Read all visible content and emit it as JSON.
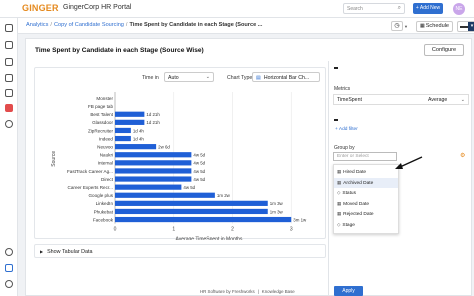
{
  "header": {
    "logo": "GINGER",
    "portal": "GingerCorp HR Portal",
    "search_placeholder": "Search",
    "add_new": "+ Add New",
    "avatar_initials": "NE"
  },
  "breadcrumb": {
    "items": [
      "Analytics",
      "Copy of Candidate Sourcing"
    ],
    "current": "Time Spent by Candidate in each Stage (Source ...",
    "schedule": "Schedule"
  },
  "page": {
    "title": "Time Spent by Candidate in each Stage (Source Wise)",
    "configure": "Configure",
    "time_in_label": "Time in",
    "time_in_value": "Auto",
    "chart_type_label": "Chart Type",
    "chart_type_value": "Horizontal Bar Ch...",
    "show_tabular": "Show Tabular Data"
  },
  "chart_data": {
    "type": "bar",
    "orientation": "horizontal",
    "categories": [
      "Monster",
      "FB page tab",
      "Best Talent",
      "Glassdoor",
      "ZipRecruiter",
      "Indeed",
      "Neuvoo",
      "Naukri",
      "Internal",
      "FastTrack Career Ag...",
      "Direct",
      "Career Experts Recr...",
      "Google plus",
      "LinkedIn",
      "Phukebat",
      "Facebook"
    ],
    "values": [
      0,
      0,
      0.5,
      0.5,
      0.27,
      0.27,
      0.7,
      1.3,
      1.3,
      1.3,
      1.3,
      1.13,
      1.7,
      2.6,
      2.6,
      3.0
    ],
    "data_labels": [
      "",
      "",
      "1d 21h",
      "1d 21h",
      "1d 4h",
      "1d 4h",
      "2w 6d",
      "4w 5d",
      "4w 5d",
      "4w 5d",
      "4w 5d",
      "4w 5d",
      "1m 2w",
      "1m 3w",
      "1m 3w",
      "3m 1w"
    ],
    "xlabel": "Average TimeSpent in Months",
    "ylabel": "Source",
    "xticks": [
      "0",
      "1",
      "2",
      "3"
    ],
    "xlim": [
      0,
      3.2
    ],
    "bar_color": "#1f5fd6",
    "grid": true
  },
  "panel": {
    "metrics_label": "Metrics",
    "metric_name": "TimeSpent",
    "metric_agg": "Average",
    "add_filter": "+ Add filter",
    "group_by_label": "Group by",
    "group_by_placeholder": "Enter or Select",
    "options": [
      {
        "label": "Hired Date",
        "icon": "calendar-icon"
      },
      {
        "label": "Archived Date",
        "icon": "calendar-icon"
      },
      {
        "label": "Status",
        "icon": "tag-icon"
      },
      {
        "label": "Moved Date",
        "icon": "calendar-icon"
      },
      {
        "label": "Rejected Date",
        "icon": "calendar-icon"
      },
      {
        "label": "Stage",
        "icon": "tag-icon"
      }
    ],
    "apply": "Apply"
  },
  "footer": {
    "left": "HR Software by Freshworks",
    "right": "Knowledge Base"
  }
}
